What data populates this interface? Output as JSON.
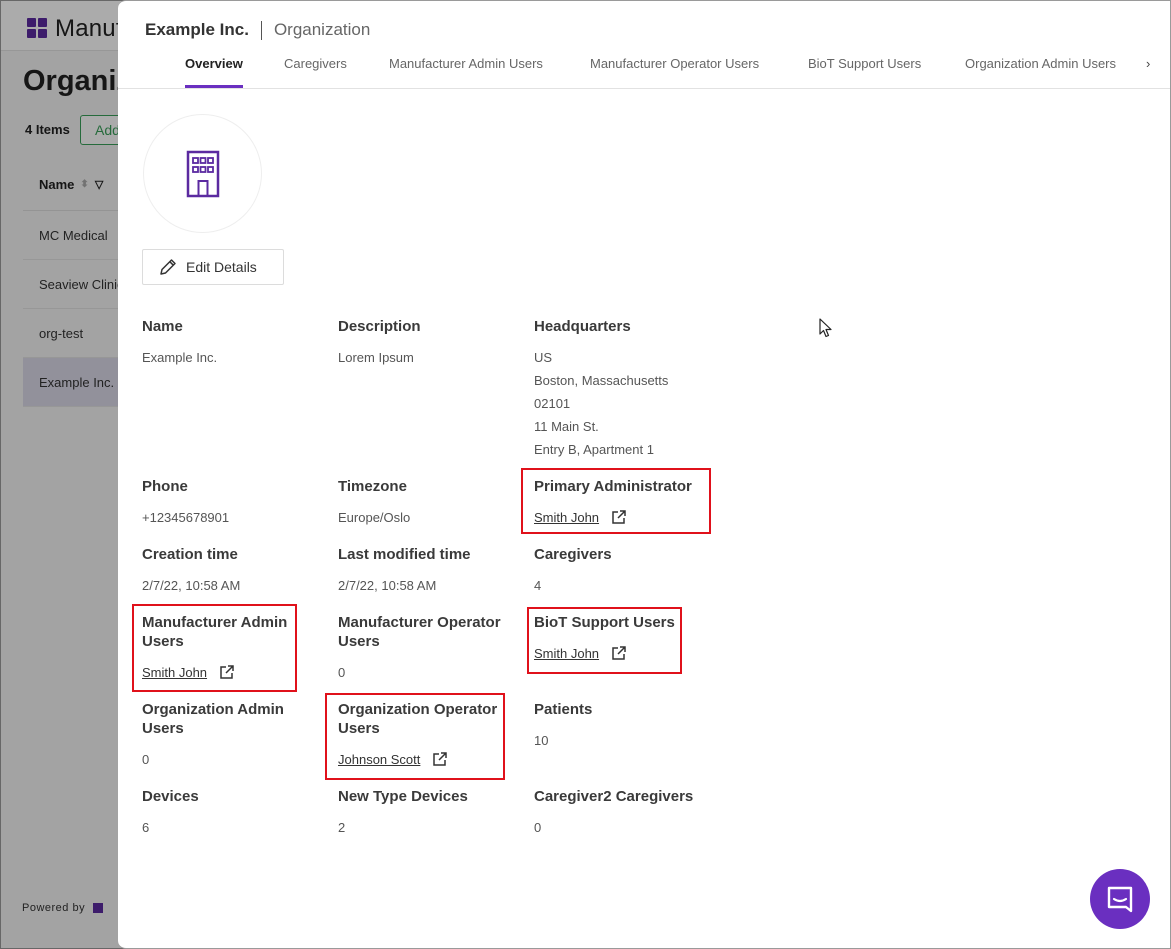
{
  "background": {
    "logo_text": "Manufacturer",
    "page_title": "Organizations",
    "items_count": "4 Items",
    "add_button": "Add",
    "column_name": "Name",
    "rows": [
      "MC Medical",
      "Seaview Clinic",
      "org-test",
      "Example Inc."
    ],
    "footer": "Powered by"
  },
  "panel": {
    "org_name": "Example Inc.",
    "entity_type": "Organization",
    "tabs": [
      "Overview",
      "Caregivers",
      "Manufacturer Admin Users",
      "Manufacturer Operator Users",
      "BioT Support Users",
      "Organization Admin Users"
    ],
    "tab_more": "›",
    "edit_button": "Edit Details"
  },
  "details": {
    "name": {
      "label": "Name",
      "value": "Example Inc."
    },
    "description": {
      "label": "Description",
      "value": "Lorem Ipsum"
    },
    "headquarters": {
      "label": "Headquarters",
      "lines": [
        "US",
        "Boston, Massachusetts",
        "02101",
        "11 Main St.",
        "Entry B, Apartment 1"
      ]
    },
    "phone": {
      "label": "Phone",
      "value": "+12345678901"
    },
    "timezone": {
      "label": "Timezone",
      "value": "Europe/Oslo"
    },
    "primary_admin": {
      "label": "Primary Administrator",
      "link": "Smith John"
    },
    "creation_time": {
      "label": "Creation time",
      "value": "2/7/22, 10:58 AM"
    },
    "last_modified": {
      "label": "Last modified time",
      "value": "2/7/22, 10:58 AM"
    },
    "caregivers": {
      "label": "Caregivers",
      "value": "4"
    },
    "mfr_admin_users": {
      "label_1": "Manufacturer Admin",
      "label_2": "Users",
      "link": "Smith John"
    },
    "mfr_operator_users": {
      "label_1": "Manufacturer Operator",
      "label_2": "Users",
      "value": "0"
    },
    "biot_support_users": {
      "label": "BioT Support Users",
      "link": "Smith John"
    },
    "org_admin_users": {
      "label_1": "Organization Admin",
      "label_2": "Users",
      "value": "0"
    },
    "org_operator_users": {
      "label_1": "Organization Operator",
      "label_2": "Users",
      "link": "Johnson Scott"
    },
    "patients": {
      "label": "Patients",
      "value": "10"
    },
    "devices": {
      "label": "Devices",
      "value": "6"
    },
    "new_type_devices": {
      "label": "New Type Devices",
      "value": "2"
    },
    "caregiver2": {
      "label": "Caregiver2 Caregivers",
      "value": "0"
    }
  },
  "colors": {
    "accent": "#6a2fc0",
    "highlight": "#e0111b"
  },
  "icons": [
    "building-icon",
    "pencil-icon",
    "external-link-icon",
    "chat-icon",
    "cursor-icon"
  ]
}
